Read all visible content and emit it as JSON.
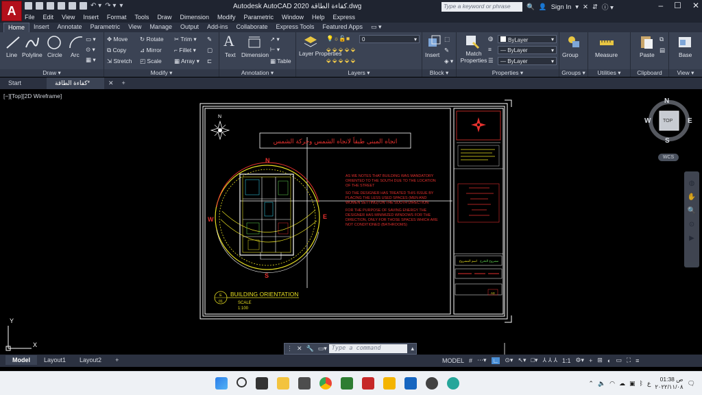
{
  "app": {
    "logo": "A",
    "title": "Autodesk AutoCAD 2020  كفاءة الطاقة.dwg",
    "search_placeholder": "Type a keyword or phrase",
    "sign_in": "Sign In"
  },
  "menu": [
    "File",
    "Edit",
    "View",
    "Insert",
    "Format",
    "Tools",
    "Draw",
    "Dimension",
    "Modify",
    "Parametric",
    "Window",
    "Help",
    "Express"
  ],
  "ribbon_tabs": [
    "Home",
    "Insert",
    "Annotate",
    "Parametric",
    "View",
    "Manage",
    "Output",
    "Add-ins",
    "Collaborate",
    "Express Tools",
    "Featured Apps"
  ],
  "draw_tools": {
    "line": "Line",
    "polyline": "Polyline",
    "circle": "Circle",
    "arc": "Arc",
    "panel": "Draw"
  },
  "modify_tools": {
    "move": "Move",
    "rotate": "Rotate",
    "trim": "Trim",
    "copy": "Copy",
    "mirror": "Mirror",
    "fillet": "Fillet",
    "stretch": "Stretch",
    "scale": "Scale",
    "array": "Array",
    "panel": "Modify"
  },
  "annotation_tools": {
    "text": "Text",
    "dimension": "Dimension",
    "table": "Table",
    "panel": "Annotation"
  },
  "layer_tools": {
    "layer_properties": "Layer Properties",
    "current_layer": "0",
    "panel": "Layers"
  },
  "block_tools": {
    "insert": "Insert",
    "panel": "Block"
  },
  "properties_tools": {
    "match": "Match Properties",
    "bylayer1": "ByLayer",
    "bylayer2": "ByLayer",
    "bylayer3": "ByLayer",
    "panel": "Properties"
  },
  "group_tools": {
    "group": "Group",
    "panel": "Groups"
  },
  "utility_tools": {
    "measure": "Measure",
    "panel": "Utilities"
  },
  "clipboard_tools": {
    "paste": "Paste",
    "panel": "Clipboard"
  },
  "view_tools": {
    "base": "Base",
    "panel": "View"
  },
  "doc_tabs": [
    "Start",
    "كفاءة الطاقة*"
  ],
  "viewport_label": "[−][Top][2D Wireframe]",
  "viewcube": {
    "n": "N",
    "s": "S",
    "e": "E",
    "w": "W",
    "top": "TOP",
    "wcs": "WCS"
  },
  "drawing": {
    "heading_ar": "اتجاه المبنى طبقاً لاتجاه الشمس وحركة الشمس",
    "compass_n": "N",
    "compass_s": "S",
    "compass_e": "E",
    "compass_w": "W",
    "note1": "AS WE NOTES THAT BUILDING WAS MANDATORY ORIENTED TO THE SOUTH DUE TO THE LOCATION OF THE STREET",
    "note2": "SO THE DESIGNER HAS TREATED THIS ISSUE BY PLACING THE LESS USED SPACES (MEN AND WOMEN SETTING) ON THE SOUTH DIRECTION",
    "note3": "FOR THE PURPOSE OF SAVING ENERGY THE DESIGNER HAS MINIMIZED WINDOWS FOR THE DIRECTION, ONLY FOR THOSE SPACES WHICH ARE NOT CONDITIONED (BATHROOMS)",
    "title_tag": "E",
    "title_num": "01",
    "title": "BUILDING ORIENTATION",
    "scale_label": "SCALE",
    "scale": "1:100",
    "titleblock_ar1": "اسم المشروع",
    "titleblock_ar2": "مشروع التخرج",
    "titleblock_sheet": "A3"
  },
  "command": {
    "placeholder": "Type a command"
  },
  "layouts": [
    "Model",
    "Layout1",
    "Layout2"
  ],
  "status": {
    "model": "MODEL",
    "scale": "1:1"
  },
  "clock": {
    "time": "01:38 ص",
    "date": "٢٠٢٢/١١/٠٨"
  },
  "colors": {
    "accent": "#b3101b",
    "cad_red": "#e5312e",
    "cad_yellow": "#e8e022",
    "cad_white": "#ffffff"
  }
}
